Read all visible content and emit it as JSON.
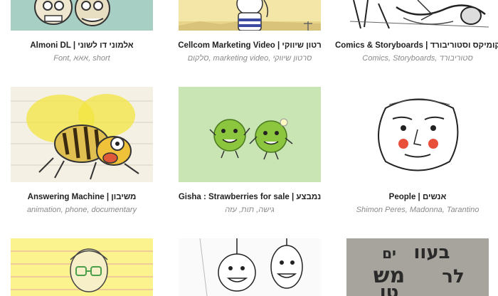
{
  "projects": [
    {
      "title": "Almoni DL | אלמוני דו לשוני",
      "tags": "Font, אאא, short"
    },
    {
      "title": "Cellcom Marketing Video | רטון שיווקי",
      "tags": "סלקום, marketing video, סרטון שיווקי"
    },
    {
      "title": "Comics & Storyboards | קומיקס וסטוריבורד",
      "tags": "Comics, Storyboards, סטוריבורד"
    },
    {
      "title": "Answering Machine | משיבון",
      "tags": "animation, phone, documentary"
    },
    {
      "title": "Gisha : Strawberries for sale | נמבצע",
      "tags": "גישה, תות, עזה"
    },
    {
      "title": "People | אנשים",
      "tags": "Shimon Peres, Madonna, Tarantino"
    },
    {
      "title": "",
      "tags": ""
    },
    {
      "title": "",
      "tags": ""
    },
    {
      "title": "",
      "tags": ""
    }
  ],
  "thumb_colors": {
    "teal": "#a8cfc4",
    "sand": "#f4e6a6",
    "green": "#c9e5b4",
    "pea": "#8cc63e",
    "bee_yellow": "#f2e640",
    "paper_yellow": "#fbf38d",
    "poster_gray": "#9a9791"
  },
  "poster_text": [
    "בעוו",
    "ים",
    "מש",
    "לר",
    "טו"
  ]
}
